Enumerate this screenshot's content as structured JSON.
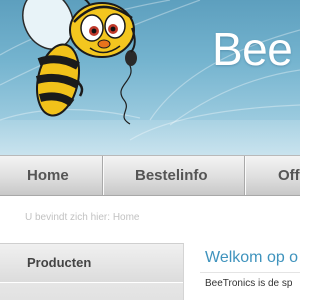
{
  "brand": {
    "title": "Bee"
  },
  "nav": {
    "items": [
      "Home",
      "Bestelinfo",
      "Off"
    ]
  },
  "breadcrumb": {
    "text": "U bevindt zich hier: Home"
  },
  "sidebar": {
    "title": "Producten"
  },
  "main": {
    "welcome_title": "Welkom op o",
    "intro_text": "BeeTronics is de sp"
  },
  "colors": {
    "header_blue": "#75b4cf",
    "accent_blue": "#3f93bd",
    "nav_text": "#555555",
    "bee_yellow": "#f2c21a"
  },
  "icons": {
    "mascot": "bee-mascot-with-headset"
  }
}
